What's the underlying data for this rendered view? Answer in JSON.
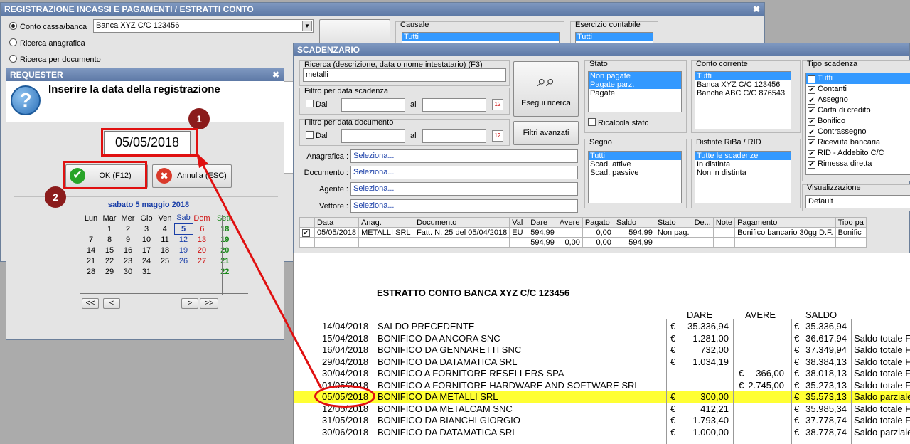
{
  "main_window": {
    "title": "REGISTRAZIONE INCASSI E PAGAMENTI / ESTRATTI CONTO",
    "radio_conto": "Conto cassa/banca",
    "radio_anagrafica": "Ricerca anagrafica",
    "radio_documento": "Ricerca per documento",
    "conto_value": "Banca XYZ C/C 123456",
    "causale_label": "Causale",
    "causale_value": "Tutti",
    "esercizio_label": "Esercizio contabile",
    "esercizio_value": "Tutti"
  },
  "scadenzario": {
    "title": "SCADENZARIO",
    "ricerca_label": "Ricerca (descrizione, data o nome intestatario) (F3)",
    "ricerca_value": "metalli",
    "filtro_scadenza_label": "Filtro per data scadenza",
    "filtro_documento_label": "Filtro per data documento",
    "dal": "Dal",
    "al": "al",
    "esegui_ricerca": "Esegui ricerca",
    "filtri_avanzati": "Filtri avanzati",
    "anagrafica_label": "Anagrafica :",
    "documento_label": "Documento :",
    "agente_label": "Agente :",
    "vettore_label": "Vettore :",
    "seleziona": "Seleziona...",
    "stato_label": "Stato",
    "stato_items": [
      "Non pagate",
      "Pagate parz.",
      "Pagate"
    ],
    "ricalcola": "Ricalcola stato",
    "segno_label": "Segno",
    "segno_items": [
      "Tutti",
      "Scad. attive",
      "Scad. passive"
    ],
    "conto_label": "Conto corrente",
    "conto_items": [
      "Tutti",
      "Banca XYZ C/C 123456",
      "Banche ABC C/C 876543"
    ],
    "distinte_label": "Distinte RiBa / RID",
    "distinte_items": [
      "Tutte le scadenze",
      "In distinta",
      "Non in distinta"
    ],
    "tipo_label": "Tipo scadenza",
    "tipo_items": [
      "Tutti",
      "Contanti",
      "Assegno",
      "Carta di credito",
      "Bonifico",
      "Contrassegno",
      "Ricevuta bancaria",
      "RID - Addebito C/C",
      "Rimessa diretta"
    ],
    "visualizzazione_label": "Visualizzazione",
    "visualizzazione_value": "Default",
    "grid_headers": [
      "Data",
      "Anag.",
      "Documento",
      "Val",
      "Dare",
      "Avere",
      "Pagato",
      "Saldo",
      "Stato",
      "De...",
      "Note",
      "Pagamento",
      "Tipo pa"
    ],
    "grid_row": [
      "05/05/2018",
      "METALLI SRL",
      "Fatt. N. 25 del 05/04/2018",
      "EU",
      "594,99",
      "",
      "0,00",
      "594,99",
      "Non pag.",
      "",
      "",
      "Bonifico bancario 30gg D.F.",
      "Bonific"
    ],
    "grid_totals": [
      "594,99",
      "0,00",
      "0,00",
      "594,99"
    ]
  },
  "requester": {
    "title": "REQUESTER",
    "question": "Inserire la data della registrazione",
    "date_value": "05/05/2018",
    "ok_label": "OK (F12)",
    "cancel_label": "Annulla (ESC)",
    "calendar_title": "sabato 5 maggio 2018",
    "weekdays": [
      "Lun",
      "Mar",
      "Mer",
      "Gio",
      "Ven",
      "Sab",
      "Dom",
      "Sett."
    ],
    "weeks": [
      {
        "days": [
          "",
          "1",
          "2",
          "3",
          "4",
          "5",
          "6"
        ],
        "week": "18"
      },
      {
        "days": [
          "7",
          "8",
          "9",
          "10",
          "11",
          "12",
          "13"
        ],
        "week": "19"
      },
      {
        "days": [
          "14",
          "15",
          "16",
          "17",
          "18",
          "19",
          "20"
        ],
        "week": "20"
      },
      {
        "days": [
          "21",
          "22",
          "23",
          "24",
          "25",
          "26",
          "27"
        ],
        "week": "21"
      },
      {
        "days": [
          "28",
          "29",
          "30",
          "31",
          "",
          "",
          ""
        ],
        "week": "22"
      }
    ],
    "nav": [
      "<<",
      "<",
      ">",
      ">>"
    ]
  },
  "annotations": {
    "one": "1",
    "two": "2"
  },
  "statement": {
    "title": "ESTRATTO CONTO BANCA XYZ C/C 123456",
    "col_dare": "DARE",
    "col_avere": "AVERE",
    "col_saldo": "SALDO",
    "currency": "€",
    "rows": [
      {
        "date": "14/04/2018",
        "desc": "SALDO PRECEDENTE",
        "dare": "35.336,94",
        "avere": "",
        "saldo": "35.336,94",
        "note": ""
      },
      {
        "date": "15/04/2018",
        "desc": "BONIFICO DA ANCORA SNC",
        "dare": "1.281,00",
        "avere": "",
        "saldo": "36.617,94",
        "note": "Saldo totale F"
      },
      {
        "date": "16/04/2018",
        "desc": "BONIFICO DA GENNARETTI SNC",
        "dare": "732,00",
        "avere": "",
        "saldo": "37.349,94",
        "note": "Saldo totale F"
      },
      {
        "date": "29/04/2018",
        "desc": "BONIFICO DA DATAMATICA SRL",
        "dare": "1.034,19",
        "avere": "",
        "saldo": "38.384,13",
        "note": "Saldo totale F"
      },
      {
        "date": "30/04/2018",
        "desc": "BONIFICO A FORNITORE RESELLERS SPA",
        "dare": "",
        "avere": "366,00",
        "saldo": "38.018,13",
        "note": "Saldo totale F"
      },
      {
        "date": "01/05/2018",
        "desc": "BONIFICO A FORNITORE HARDWARE AND SOFTWARE SRL",
        "dare": "",
        "avere": "2.745,00",
        "saldo": "35.273,13",
        "note": "Saldo totale F"
      },
      {
        "date": "05/05/2018",
        "desc": "BONIFICO DA METALLI SRL",
        "dare": "300,00",
        "avere": "",
        "saldo": "35.573,13",
        "note": "Saldo parziale"
      },
      {
        "date": "12/05/2018",
        "desc": "BONIFICO DA METALCAM SNC",
        "dare": "412,21",
        "avere": "",
        "saldo": "35.985,34",
        "note": "Saldo totale F"
      },
      {
        "date": "31/05/2018",
        "desc": "BONIFICO DA BIANCHI GIORGIO",
        "dare": "1.793,40",
        "avere": "",
        "saldo": "37.778,74",
        "note": "Saldo totale F"
      },
      {
        "date": "30/06/2018",
        "desc": "BONIFICO DA DATAMATICA SRL",
        "dare": "1.000,00",
        "avere": "",
        "saldo": "38.778,74",
        "note": "Saldo parziale"
      }
    ]
  }
}
